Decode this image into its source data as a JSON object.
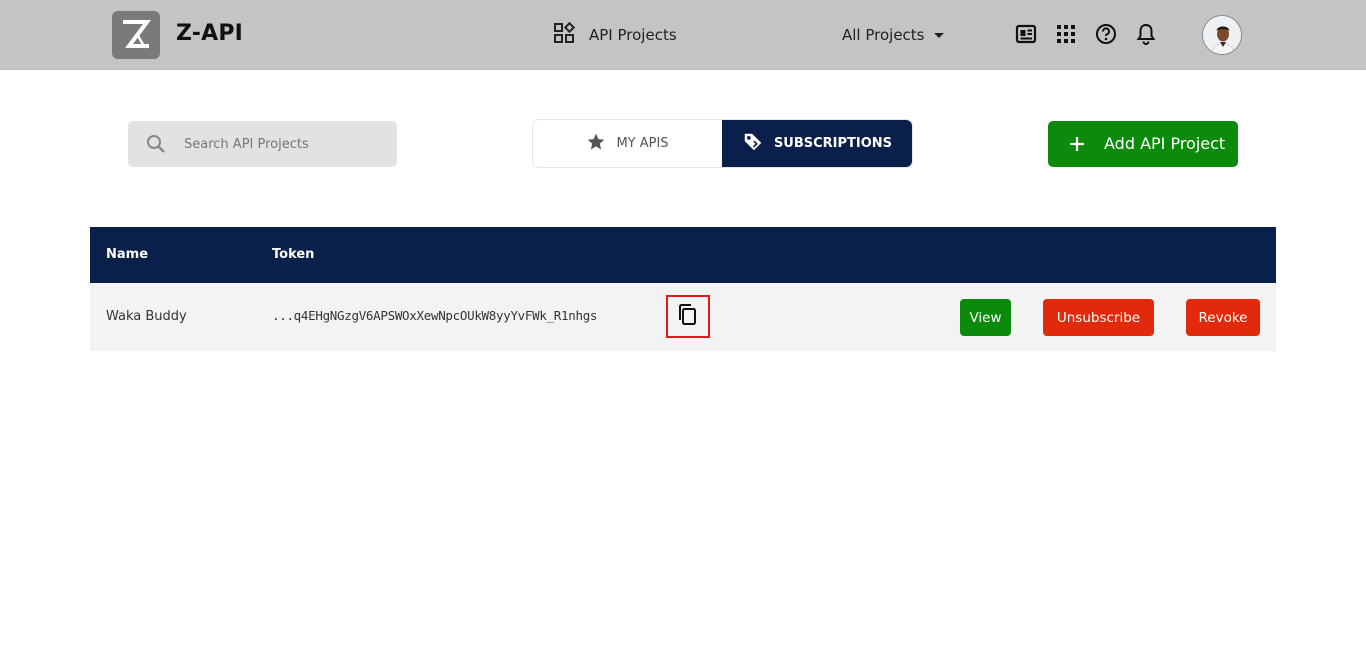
{
  "app": {
    "brand": "Z-API"
  },
  "nav": {
    "projects_label": "API Projects",
    "filter_label": "All Projects"
  },
  "icons": {
    "logo": "z-logo-icon",
    "projects": "apps-icon",
    "docs": "docs-icon",
    "grid": "grid-icon",
    "help": "help-circle-icon",
    "notifications": "bell-icon",
    "search": "search-icon",
    "star": "star-icon",
    "tag": "tag-icon",
    "plus": "plus-icon",
    "copy": "copy-icon"
  },
  "search": {
    "placeholder": "Search API Projects",
    "value": ""
  },
  "tabs": [
    {
      "label": "MY APIS",
      "active": false
    },
    {
      "label": "SUBSCRIPTIONS",
      "active": true
    }
  ],
  "add_button": {
    "label": "Add API Project"
  },
  "table": {
    "headers": {
      "name": "Name",
      "token": "Token"
    },
    "rows": [
      {
        "name": "Waka Buddy",
        "token": "...q4EHgNGzgV6APSWOxXewNpcOUkW8yyYvFWk_R1nhgs",
        "actions": {
          "view": "View",
          "unsubscribe": "Unsubscribe",
          "revoke": "Revoke"
        }
      }
    ]
  },
  "colors": {
    "topbar": "#c4c4c4",
    "navy": "#0b1f4b",
    "green": "#0b8a0b",
    "red": "#e1290c",
    "highlight": "#e01a1a"
  }
}
